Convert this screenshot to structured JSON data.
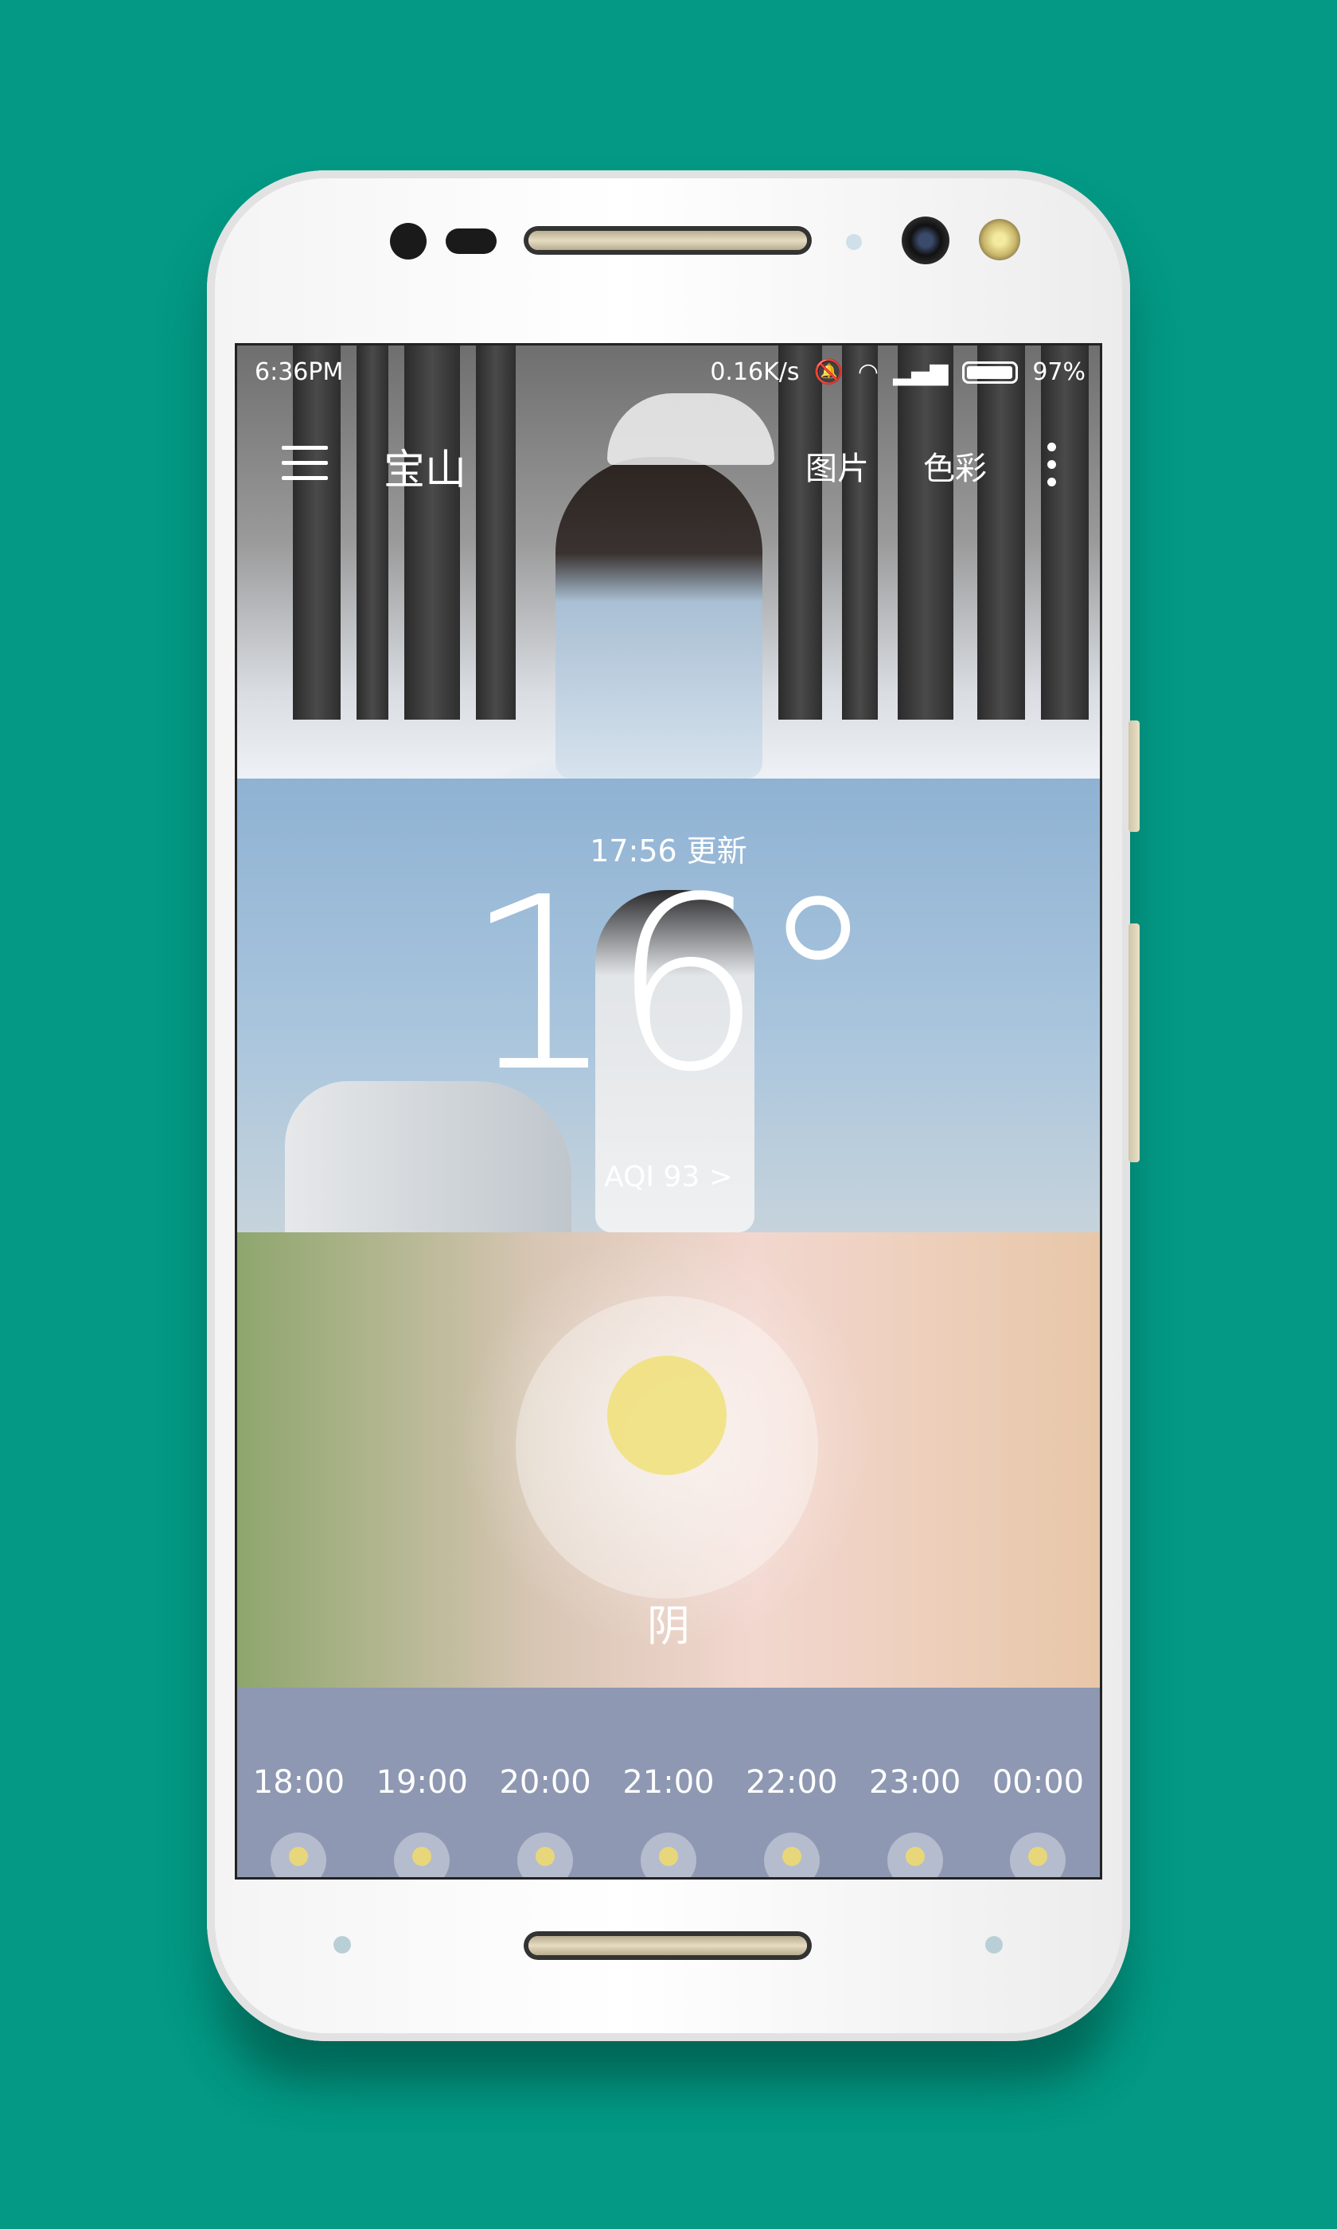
{
  "status_bar": {
    "time": "6:36PM",
    "net_speed": "0.16K/s",
    "battery": "97%"
  },
  "toolbar": {
    "city": "宝山",
    "pictures_label": "图片",
    "colors_label": "色彩"
  },
  "weather": {
    "update_text": "17:56 更新",
    "temperature": "16°",
    "aqi": "AQI 93 >",
    "condition": "阴"
  },
  "hourly": [
    {
      "time": "18:00"
    },
    {
      "time": "19:00"
    },
    {
      "time": "20:00"
    },
    {
      "time": "21:00"
    },
    {
      "time": "22:00"
    },
    {
      "time": "23:00"
    },
    {
      "time": "00:00"
    }
  ],
  "colors": {
    "background": "#039985",
    "hourly_bar": "#8e98b2"
  }
}
